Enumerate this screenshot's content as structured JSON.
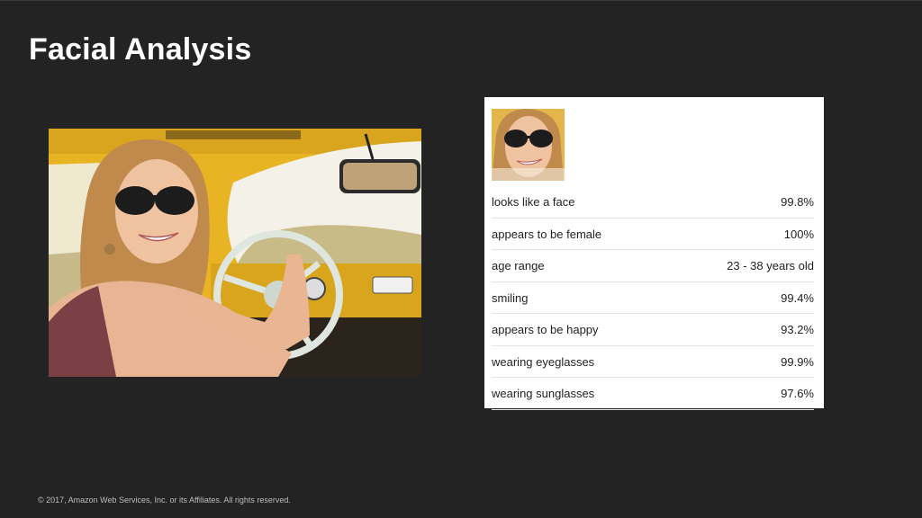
{
  "slide": {
    "title": "Facial Analysis",
    "footer": "© 2017, Amazon Web Services, Inc. or its Affiliates. All rights reserved.",
    "background_color": "#232323"
  },
  "photo": {
    "subject": "woman-wearing-sunglasses-driving-yellow-car"
  },
  "results": [
    {
      "label": "looks like a face",
      "value": "99.8%"
    },
    {
      "label": "appears to be female",
      "value": "100%"
    },
    {
      "label": "age range",
      "value": "23 - 38 years old"
    },
    {
      "label": "smiling",
      "value": "99.4%"
    },
    {
      "label": "appears to be happy",
      "value": "93.2%"
    },
    {
      "label": "wearing eyeglasses",
      "value": "99.9%"
    },
    {
      "label": "wearing sunglasses",
      "value": "97.6%"
    }
  ]
}
